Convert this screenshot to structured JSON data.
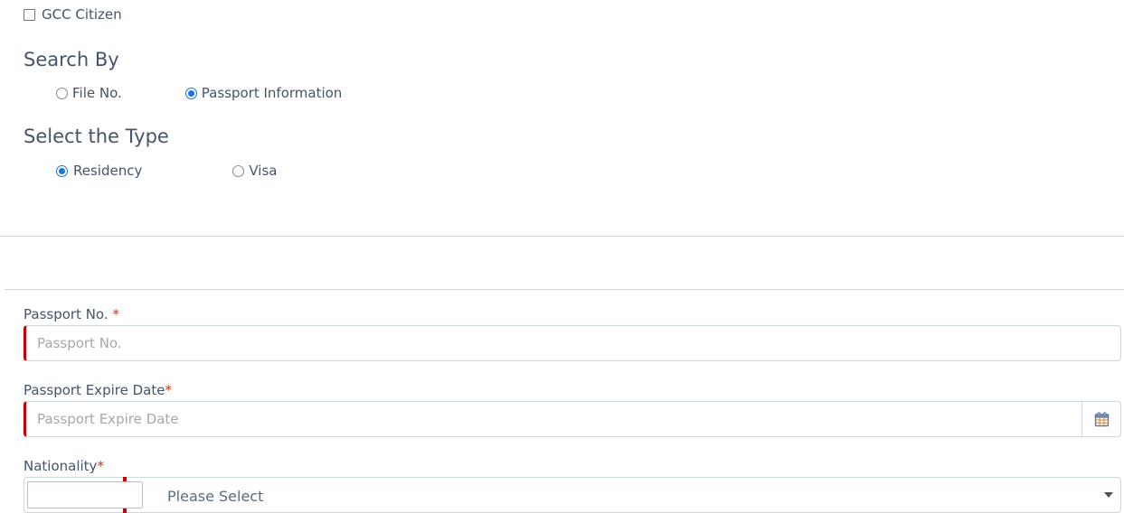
{
  "gcc": {
    "label": "GCC Citizen",
    "checked": false,
    "icon": "checkbox-unchecked-icon"
  },
  "search_by": {
    "heading": "Search By",
    "options": [
      {
        "label": "File No.",
        "selected": false
      },
      {
        "label": "Passport Information",
        "selected": true
      }
    ]
  },
  "select_type": {
    "heading": "Select the Type",
    "options": [
      {
        "label": "Residency",
        "selected": true
      },
      {
        "label": "Visa",
        "selected": false
      }
    ]
  },
  "form": {
    "passport_no": {
      "label": "Passport No. ",
      "required_mark": "*",
      "value": "",
      "placeholder": "Passport No."
    },
    "passport_expire_date": {
      "label": "Passport Expire Date",
      "required_mark": "*",
      "value": "",
      "placeholder": "Passport Expire Date",
      "calendar_icon": "calendar-icon"
    },
    "nationality": {
      "label": "Nationality",
      "required_mark": "*",
      "filter_value": "",
      "selected_value": "Please Select",
      "caret_icon": "caret-down-icon"
    }
  },
  "colors": {
    "accent_blue": "#1a73e8",
    "required_red": "#cc0000",
    "asterisk_red": "#c0392b",
    "text": "#44546a",
    "placeholder": "#a8a8a8",
    "border": "#cfd8dc",
    "rule": "#d6d6d6"
  }
}
